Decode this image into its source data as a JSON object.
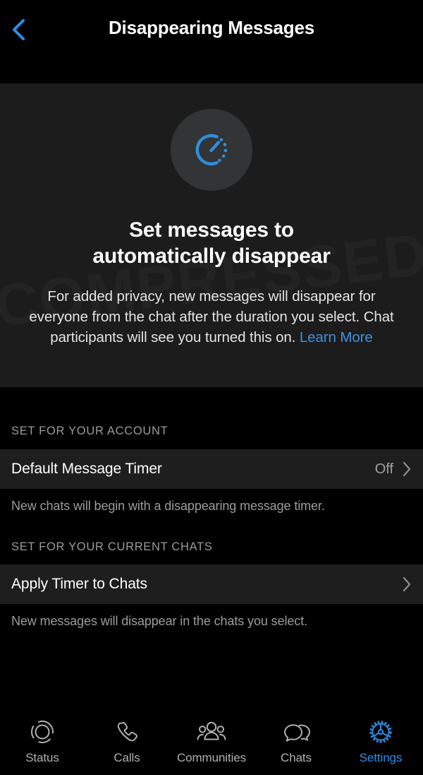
{
  "header": {
    "title": "Disappearing Messages",
    "back_icon": "chevron-left-icon",
    "accent_color": "#2a8fea"
  },
  "hero": {
    "icon": "disappearing-timer-icon",
    "icon_color": "#2f8ee0",
    "watermark": "COMPRESSED",
    "title_line1": "Set messages to",
    "title_line2": "automatically disappear",
    "description": "For added privacy, new messages will disappear for everyone from the chat after the duration you select. Chat participants will see you turned this on. ",
    "learn_more": "Learn More",
    "learn_more_color": "#3f90e0"
  },
  "sections": [
    {
      "header": "SET FOR YOUR ACCOUNT",
      "row": {
        "label": "Default Message Timer",
        "value": "Off",
        "chevron": "chevron-right-icon"
      },
      "footer": "New chats will begin with a disappearing message timer."
    },
    {
      "header": "SET FOR YOUR CURRENT CHATS",
      "row": {
        "label": "Apply Timer to Chats",
        "value": "",
        "chevron": "chevron-right-icon"
      },
      "footer": "New messages will disappear in the chats you select."
    }
  ],
  "tabbar": {
    "active_color": "#2a8fea",
    "inactive_color": "#b0b0b0",
    "items": [
      {
        "label": "Status",
        "icon": "status-ring-icon",
        "active": false
      },
      {
        "label": "Calls",
        "icon": "phone-icon",
        "active": false
      },
      {
        "label": "Communities",
        "icon": "people-group-icon",
        "active": false
      },
      {
        "label": "Chats",
        "icon": "chat-bubbles-icon",
        "active": false
      },
      {
        "label": "Settings",
        "icon": "gear-icon",
        "active": true
      }
    ]
  }
}
